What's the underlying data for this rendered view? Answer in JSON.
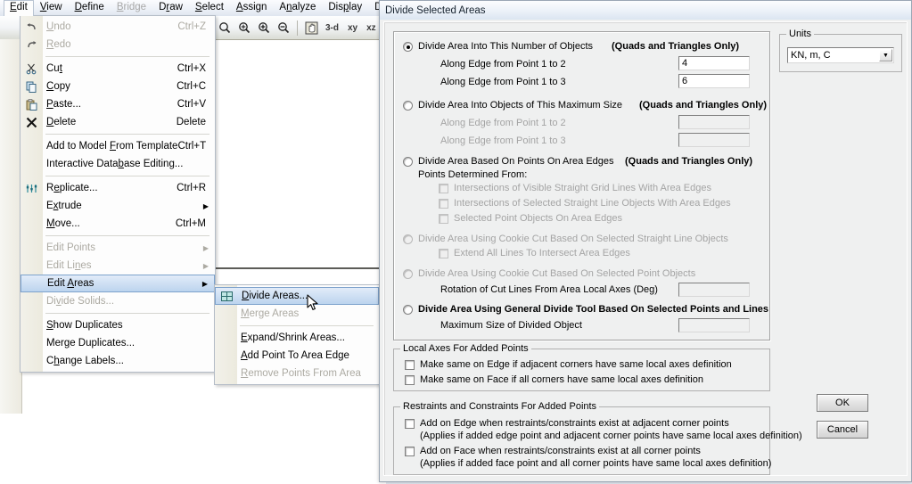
{
  "menubar": {
    "items": [
      {
        "label": "Edit",
        "mnemonic": "E",
        "active": true,
        "disabled": false
      },
      {
        "label": "View",
        "mnemonic": "V",
        "active": false,
        "disabled": false
      },
      {
        "label": "Define",
        "mnemonic": "D",
        "active": false,
        "disabled": false
      },
      {
        "label": "Bridge",
        "mnemonic": "B",
        "active": false,
        "disabled": true
      },
      {
        "label": "Draw",
        "mnemonic": "r",
        "active": false,
        "disabled": false
      },
      {
        "label": "Select",
        "mnemonic": "S",
        "active": false,
        "disabled": false
      },
      {
        "label": "Assign",
        "mnemonic": "A",
        "active": false,
        "disabled": false
      },
      {
        "label": "Analyze",
        "mnemonic": "n",
        "active": false,
        "disabled": false
      },
      {
        "label": "Display",
        "mnemonic": "p",
        "active": false,
        "disabled": false
      },
      {
        "label": "Desig",
        "mnemonic": "",
        "active": false,
        "disabled": false
      }
    ]
  },
  "toolbar": {
    "buttons": [
      {
        "icon": "zoom-icon",
        "glyph": "⌕"
      },
      {
        "icon": "zoom-in-window-icon",
        "glyph": "⌕"
      },
      {
        "icon": "zoom-in-icon",
        "glyph": "⌕"
      },
      {
        "icon": "zoom-out-icon",
        "glyph": "⌕"
      }
    ],
    "pan_icon": "pan-hand-icon",
    "views": [
      "3-d",
      "xy",
      "xz"
    ]
  },
  "edit_menu": {
    "items": [
      {
        "label": "Undo",
        "mnemonic": "U",
        "accel": "Ctrl+Z",
        "disabled": true,
        "icon": "undo-icon",
        "submenu": false
      },
      {
        "label": "Redo",
        "mnemonic": "R",
        "accel": "",
        "disabled": true,
        "icon": "redo-icon",
        "submenu": false
      },
      {
        "separator": true
      },
      {
        "label": "Cut",
        "mnemonic": "t",
        "accel": "Ctrl+X",
        "disabled": false,
        "icon": "scissors-icon",
        "submenu": false
      },
      {
        "label": "Copy",
        "mnemonic": "C",
        "accel": "Ctrl+C",
        "disabled": false,
        "icon": "copy-icon",
        "submenu": false
      },
      {
        "label": "Paste...",
        "mnemonic": "P",
        "accel": "Ctrl+V",
        "disabled": false,
        "icon": "paste-icon",
        "submenu": false
      },
      {
        "label": "Delete",
        "mnemonic": "D",
        "accel": "Delete",
        "disabled": false,
        "icon": "delete-x-icon",
        "submenu": false
      },
      {
        "separator": true
      },
      {
        "label": "Add to Model From Template",
        "mnemonic": "F",
        "accel": "Ctrl+T",
        "disabled": false,
        "icon": "",
        "submenu": false
      },
      {
        "label": "Interactive Database Editing...",
        "mnemonic": "b",
        "accel": "",
        "disabled": false,
        "icon": "",
        "submenu": false
      },
      {
        "separator": true
      },
      {
        "label": "Replicate...",
        "mnemonic": "e",
        "accel": "Ctrl+R",
        "disabled": false,
        "icon": "replicate-icon",
        "submenu": false
      },
      {
        "label": "Extrude",
        "mnemonic": "x",
        "accel": "",
        "disabled": false,
        "icon": "",
        "submenu": true
      },
      {
        "label": "Move...",
        "mnemonic": "M",
        "accel": "Ctrl+M",
        "disabled": false,
        "icon": "",
        "submenu": false
      },
      {
        "separator": true
      },
      {
        "label": "Edit Points",
        "mnemonic": "",
        "accel": "",
        "disabled": true,
        "icon": "",
        "submenu": true
      },
      {
        "label": "Edit Lines",
        "mnemonic": "n",
        "accel": "",
        "disabled": true,
        "icon": "",
        "submenu": true
      },
      {
        "label": "Edit Areas",
        "mnemonic": "A",
        "accel": "",
        "disabled": false,
        "icon": "",
        "submenu": true,
        "highlight": true
      },
      {
        "label": "Divide Solids...",
        "mnemonic": "v",
        "accel": "",
        "disabled": true,
        "icon": "",
        "submenu": false
      },
      {
        "separator": true
      },
      {
        "label": "Show Duplicates",
        "mnemonic": "S",
        "accel": "",
        "disabled": false,
        "icon": "",
        "submenu": false
      },
      {
        "label": "Merge Duplicates...",
        "mnemonic": "g",
        "accel": "",
        "disabled": false,
        "icon": "",
        "submenu": false
      },
      {
        "label": "Change Labels...",
        "mnemonic": "h",
        "accel": "",
        "disabled": false,
        "icon": "",
        "submenu": false
      }
    ]
  },
  "sub_menu": {
    "items": [
      {
        "label": "Divide Areas...",
        "mnemonic": "D",
        "disabled": false,
        "icon": "divide-areas-icon",
        "highlight": true
      },
      {
        "label": "Merge Areas",
        "mnemonic": "M",
        "disabled": true,
        "icon": ""
      },
      {
        "separator": true
      },
      {
        "label": "Expand/Shrink Areas...",
        "mnemonic": "E",
        "disabled": false,
        "icon": ""
      },
      {
        "label": "Add Point To Area Edge",
        "mnemonic": "A",
        "disabled": false,
        "icon": ""
      },
      {
        "label": "Remove Points From Area",
        "mnemonic": "R",
        "disabled": true,
        "icon": ""
      }
    ]
  },
  "dialog": {
    "title": "Divide Selected Areas",
    "units": {
      "group_title": "Units",
      "value": "KN, m, C"
    },
    "options": [
      {
        "id": "divide-number-of-objects",
        "label": "Divide Area Into This Number of Objects",
        "suffix": "(Quads and Triangles Only)",
        "checked": true,
        "disabled": false,
        "fields": [
          {
            "label": "Along Edge from Point 1 to 2",
            "value": "4",
            "disabled": false
          },
          {
            "label": "Along Edge from Point 1 to 3",
            "value": "6",
            "disabled": false
          }
        ]
      },
      {
        "id": "divide-max-size",
        "label": "Divide Area Into Objects of This Maximum Size",
        "suffix": "(Quads and Triangles Only)",
        "checked": false,
        "disabled": false,
        "fields": [
          {
            "label": "Along Edge from Point 1 to 2",
            "value": "",
            "disabled": true
          },
          {
            "label": "Along Edge from Point 1 to 3",
            "value": "",
            "disabled": true
          }
        ]
      },
      {
        "id": "divide-points-on-edges",
        "label": "Divide Area Based On Points On Area Edges",
        "suffix": "(Quads and Triangles Only)",
        "checked": false,
        "disabled": false,
        "sublabel": "Points Determined From:",
        "checkboxes": [
          {
            "label": "Intersections of Visible Straight Grid Lines With Area Edges",
            "checked": false,
            "disabled": true
          },
          {
            "label": "Intersections of Selected Straight Line Objects With Area Edges",
            "checked": false,
            "disabled": true
          },
          {
            "label": "Selected Point Objects On Area Edges",
            "checked": false,
            "disabled": true
          }
        ]
      },
      {
        "id": "divide-cookie-cut-lines",
        "label": "Divide Area Using Cookie Cut Based On Selected Straight Line Objects",
        "suffix": "",
        "checked": false,
        "disabled": true,
        "checkboxes": [
          {
            "label": "Extend All Lines To Intersect Area Edges",
            "checked": false,
            "disabled": true
          }
        ]
      },
      {
        "id": "divide-cookie-cut-points",
        "label": "Divide Area Using Cookie Cut Based On Selected Point Objects",
        "suffix": "",
        "checked": false,
        "disabled": true,
        "fields": [
          {
            "label": "Rotation of Cut Lines From Area Local Axes (Deg)",
            "value": "",
            "disabled": true
          }
        ]
      },
      {
        "id": "divide-general-tool",
        "label": "Divide Area Using General Divide Tool Based On Selected Points and Lines",
        "suffix": "",
        "checked": false,
        "disabled": false,
        "bold": true,
        "fields": [
          {
            "label": "Maximum Size of Divided Object",
            "value": "",
            "disabled": true
          }
        ]
      }
    ],
    "local_axes_group": {
      "title": "Local Axes For Added Points",
      "checkboxes": [
        {
          "label": "Make same on Edge if adjacent corners have same local axes definition",
          "checked": false
        },
        {
          "label": "Make same on Face if all corners have same local axes definition",
          "checked": false
        }
      ]
    },
    "restraints_group": {
      "title": "Restraints and Constraints For Added Points",
      "checkboxes": [
        {
          "label": "Add on Edge when restraints/constraints exist at adjacent corner points",
          "note": "(Applies if added edge point and adjacent corner points have same local axes definition)",
          "checked": false
        },
        {
          "label": "Add on Face when restraints/constraints exist at all corner points",
          "note": "(Applies if added face point and all corner points have same local axes definition)",
          "checked": false
        }
      ]
    },
    "buttons": {
      "ok": "OK",
      "cancel": "Cancel"
    }
  }
}
